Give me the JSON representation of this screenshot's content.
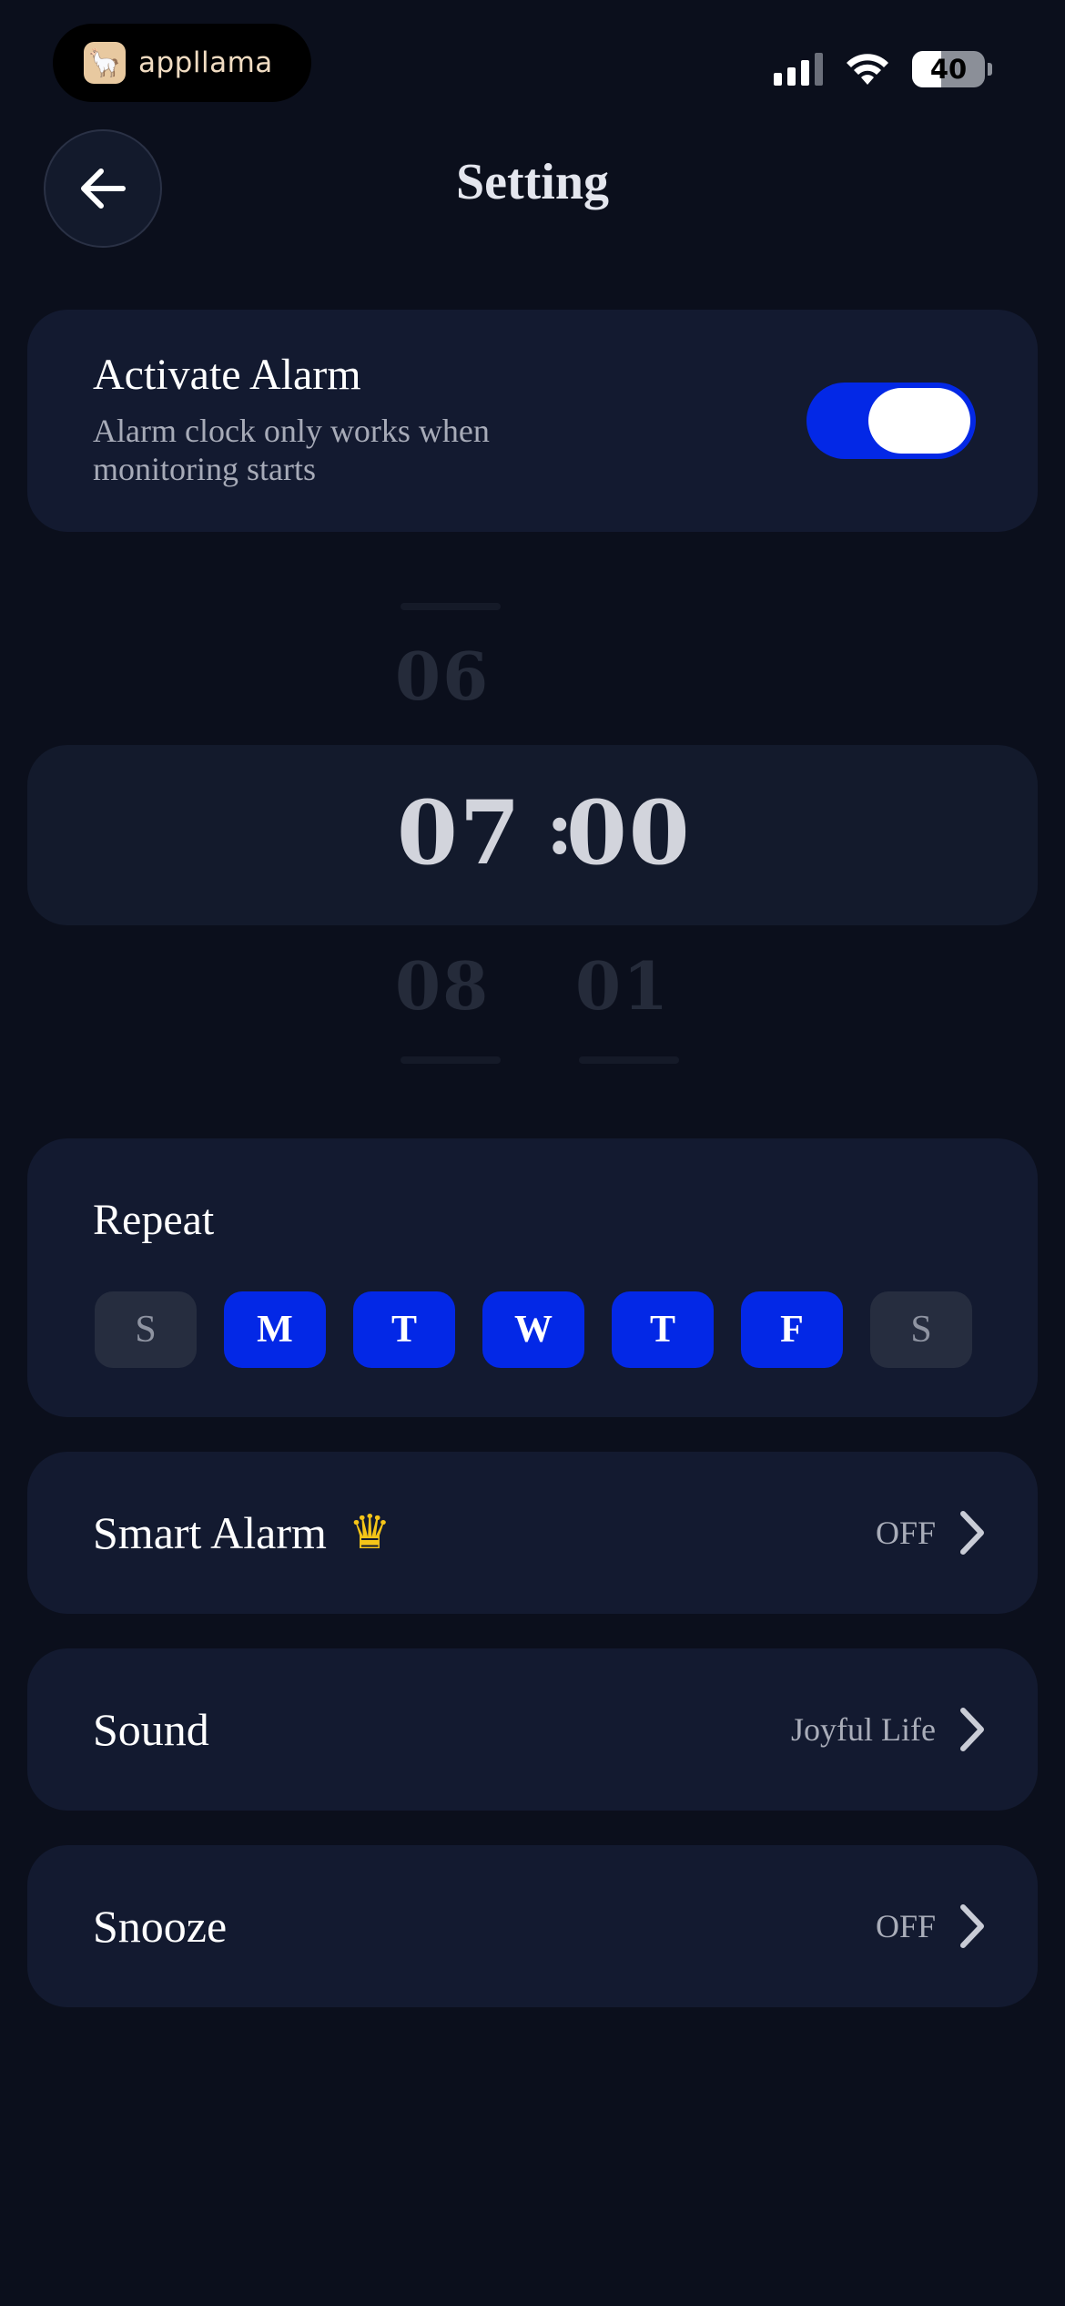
{
  "status_bar": {
    "brand_name": "appllama",
    "battery_level": "40",
    "battery_fraction": 0.4
  },
  "header": {
    "title": "Setting"
  },
  "activate_alarm": {
    "title": "Activate Alarm",
    "description": "Alarm clock only works when monitoring starts",
    "enabled": true
  },
  "time_picker": {
    "hour_above": "06",
    "hour": "07",
    "separator": ":",
    "minute": "00",
    "hour_below": "08",
    "minute_below": "01"
  },
  "repeat": {
    "title": "Repeat",
    "days": [
      {
        "label": "S",
        "selected": false
      },
      {
        "label": "M",
        "selected": true
      },
      {
        "label": "T",
        "selected": true
      },
      {
        "label": "W",
        "selected": true
      },
      {
        "label": "T",
        "selected": true
      },
      {
        "label": "F",
        "selected": true
      },
      {
        "label": "S",
        "selected": false
      }
    ]
  },
  "smart_alarm": {
    "label": "Smart Alarm",
    "badge_icon": "crown-icon",
    "value": "OFF"
  },
  "sound": {
    "label": "Sound",
    "value": "Joyful Life"
  },
  "snooze": {
    "label": "Snooze",
    "value": "OFF"
  },
  "colors": {
    "accent": "#0328e6",
    "background": "#0b0f1c",
    "card": "#131a30"
  }
}
